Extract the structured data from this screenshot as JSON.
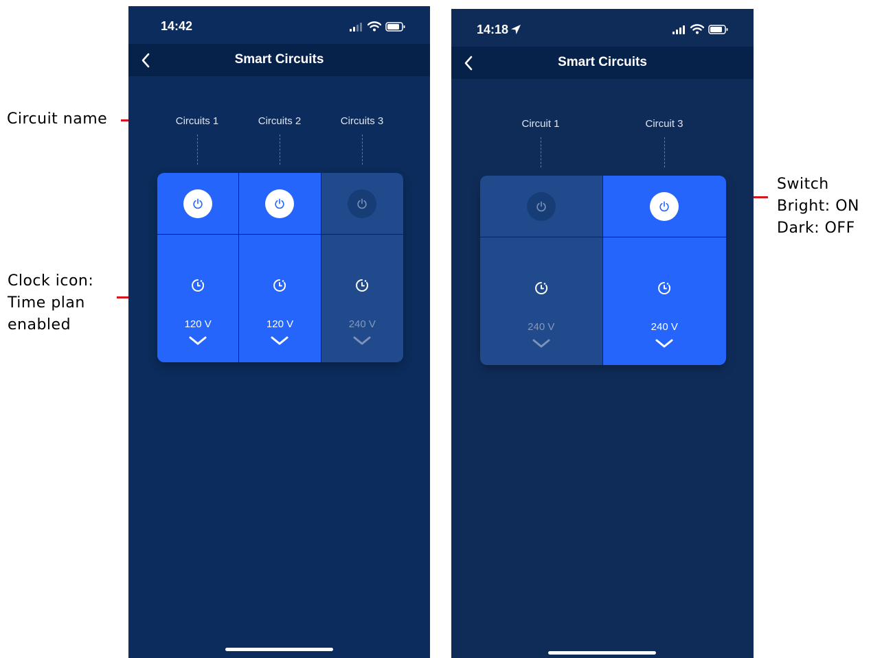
{
  "annotations": {
    "circuit_name": "Circuit name",
    "clock_icon": "Clock icon:\nTime plan\nenabled",
    "switch": "Switch\nBright: ON\nDark: OFF"
  },
  "colors": {
    "on": "#2565fb",
    "off": "#204a8c",
    "background": "#0b2c5c",
    "annotation_line": "#d9141b"
  },
  "left_screen": {
    "status_time": "14:42",
    "title": "Smart Circuits",
    "back_icon": "chevron-left-icon",
    "circuits": [
      {
        "name": "Circuits 1",
        "state": "on",
        "voltage": "120 V",
        "time_plan": true
      },
      {
        "name": "Circuits 2",
        "state": "on",
        "voltage": "120 V",
        "time_plan": true
      },
      {
        "name": "Circuits 3",
        "state": "off",
        "voltage": "240 V",
        "time_plan": true
      }
    ]
  },
  "right_screen": {
    "status_time": "14:18",
    "location_icon": "location-arrow-icon",
    "title": "Smart Circuits",
    "back_icon": "chevron-left-icon",
    "circuits": [
      {
        "name": "Circuit 1",
        "state": "off",
        "voltage": "240 V",
        "time_plan": true
      },
      {
        "name": "Circuit 3",
        "state": "on",
        "voltage": "240 V",
        "time_plan": true
      }
    ]
  }
}
